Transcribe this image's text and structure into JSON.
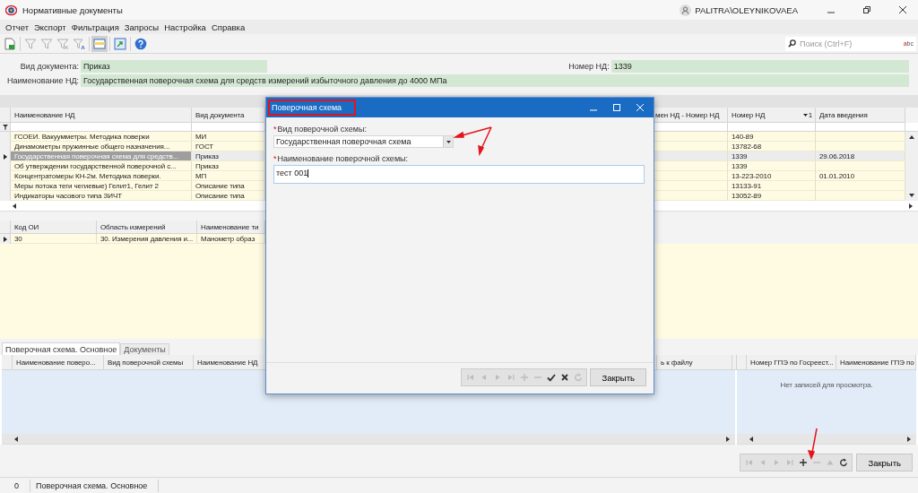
{
  "window": {
    "title": "Нормативные документы",
    "user": "PALITRA\\OLEYNIKOVAEA"
  },
  "menu": [
    "Отчет",
    "Экспорт",
    "Фильтрация",
    "Запросы",
    "Настройка",
    "Справка"
  ],
  "toolbar": [
    {
      "kind": "new",
      "disabled": false
    },
    {
      "kind": "filter",
      "disabled": true
    },
    {
      "kind": "filter",
      "disabled": true
    },
    {
      "kind": "filter-clear",
      "disabled": true
    },
    {
      "kind": "filter-text",
      "disabled": true
    },
    {
      "kind": "layout",
      "disabled": false
    },
    {
      "kind": "export",
      "disabled": false
    },
    {
      "kind": "help",
      "disabled": false
    }
  ],
  "search": {
    "placeholder": "Поиск (Ctrl+F)",
    "spell": "abc"
  },
  "filters": [
    {
      "label": "Вид документа:",
      "value": "Приказ"
    },
    {
      "label": "Номер НД:",
      "value": "1339"
    },
    {
      "label": "Наименование НД:",
      "value": "Государственная поверочная схема для средств измерений избыточного давления до 4000 МПа"
    }
  ],
  "documents": {
    "columns": [
      {
        "label": "Наименование НД"
      },
      {
        "label": "Вид документа"
      },
      {
        "label": "мен НД - Номер НД"
      },
      {
        "label": "Номер НД",
        "sort_index": "1"
      },
      {
        "label": "Дата введения"
      }
    ],
    "rows": [
      {
        "name": "ГСОЕИ. Вакуумметры. Методика поверки",
        "type": "МИ",
        "number": "140-89",
        "selected": false
      },
      {
        "name": "Динамометры пружинные общего назначения...",
        "type": "ГОСТ",
        "number": "13782-68",
        "selected": false
      },
      {
        "name": "Государственная поверочная схема для средств...",
        "type": "Приказ",
        "number": "1339",
        "date": "29.06.2018",
        "selected": true
      },
      {
        "name": "Об утверждении государственной поверочной с...",
        "type": "Приказ",
        "number": "1339",
        "selected": false
      },
      {
        "name": "Концентратомеры КН-2м. Методика поверки.",
        "type": "МП",
        "number": "13-223-2010",
        "date": "01.01.2010",
        "selected": false
      },
      {
        "name": "Меры потока теги чегиевые) Гелит1, Гелит 2",
        "type": "Описание типа",
        "number": "13133-91",
        "selected": false
      },
      {
        "name": "Индикаторы часового типа ЗИЧТ",
        "type": "Описание типа",
        "number": "13052-89",
        "selected": false
      }
    ]
  },
  "areas": {
    "columns": [
      "Код ОИ",
      "Область измерений",
      "Наименование ти"
    ],
    "rows": [
      {
        "cells": [
          "30",
          "30. Измерения давления и...",
          "Манометр образ"
        ],
        "selected": true
      }
    ]
  },
  "tabs": [
    {
      "label": "Поверочная схема. Основное",
      "selected": true
    },
    {
      "label": "Документы",
      "selected": false
    }
  ],
  "schemes": {
    "columns": [
      "Наименование поверо...",
      "Вид поверочной схемы",
      "Наименование НД",
      "ь к файлу"
    ]
  },
  "gpe": {
    "columns": [
      "Номер ГПЭ по Госреест...",
      "Наименование ГПЭ по"
    ],
    "empty_text": "Нет записей для просмотра."
  },
  "navigator": {
    "buttons": [
      {
        "kind": "first",
        "disabled": true
      },
      {
        "kind": "prev",
        "disabled": true
      },
      {
        "kind": "next",
        "disabled": true
      },
      {
        "kind": "last",
        "disabled": true
      },
      {
        "kind": "add",
        "disabled": false
      },
      {
        "kind": "remove",
        "disabled": true
      },
      {
        "kind": "up",
        "disabled": true
      },
      {
        "kind": "refresh",
        "disabled": false
      }
    ],
    "close_button": "Закрыть"
  },
  "status_bar": [
    "0",
    "Поверочная схема. Основное"
  ],
  "dialog": {
    "title": "Поверочная схема",
    "fields": [
      {
        "kind": "combo",
        "required_mark": "*",
        "label": "Вид поверочной схемы:",
        "value": "Государственная поверочная схема"
      },
      {
        "kind": "text",
        "required_mark": "*",
        "label": "Наименование поверочной схемы:",
        "value": "тест 001"
      }
    ],
    "navigator": [
      {
        "kind": "first",
        "disabled": true
      },
      {
        "kind": "prev",
        "disabled": true
      },
      {
        "kind": "next",
        "disabled": true
      },
      {
        "kind": "last",
        "disabled": true
      },
      {
        "kind": "add",
        "disabled": true
      },
      {
        "kind": "remove",
        "disabled": true
      },
      {
        "kind": "ok",
        "disabled": false
      },
      {
        "kind": "cancel",
        "disabled": false
      },
      {
        "kind": "refresh",
        "disabled": true
      }
    ],
    "close_button": "Закрыть"
  }
}
